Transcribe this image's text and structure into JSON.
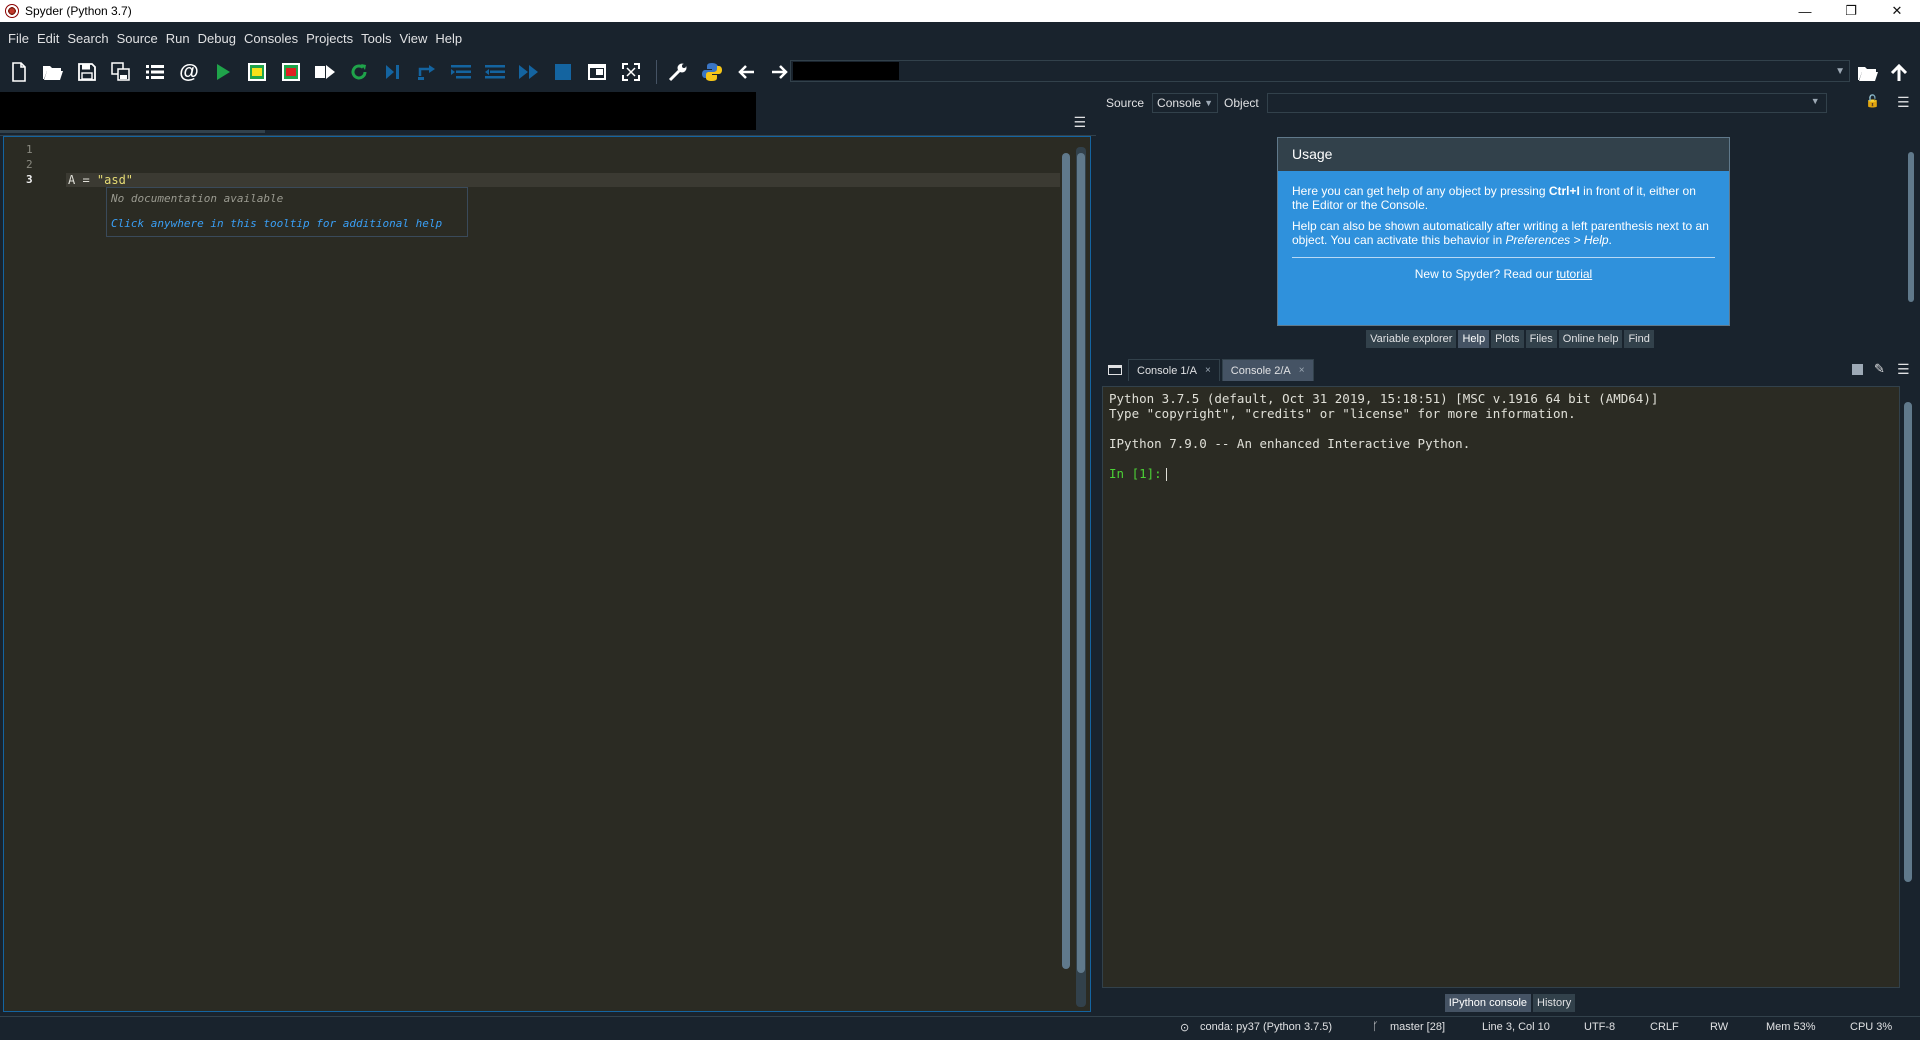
{
  "window": {
    "title": "Spyder (Python 3.7)",
    "controls": [
      "—",
      "❐",
      "✕"
    ]
  },
  "menu": [
    "File",
    "Edit",
    "Search",
    "Source",
    "Run",
    "Debug",
    "Consoles",
    "Projects",
    "Tools",
    "View",
    "Help"
  ],
  "toolbar": {
    "icons": [
      "new-file-icon",
      "open-file-icon",
      "save-icon",
      "save-all-icon",
      "outline-icon",
      "at-icon",
      "run-icon",
      "run-cell-icon",
      "run-cell-advance-icon",
      "run-selection-icon",
      "rerun-icon",
      "debug-icon",
      "step-icon",
      "step-into-icon",
      "step-return-icon",
      "continue-icon",
      "stop-debug-icon",
      "maximize-pane-icon",
      "fullscreen-icon",
      "preferences-wrench-icon",
      "python-path-icon",
      "back-arrow-icon",
      "forward-arrow-icon"
    ]
  },
  "editor": {
    "line_numbers": [
      "1",
      "2",
      "3"
    ],
    "current_line": "3",
    "code_prefix": "A = ",
    "code_string": "\"asd\"",
    "tooltip": {
      "no_doc": "No documentation available",
      "click_hint": "Click anywhere in this tooltip for additional help"
    }
  },
  "help": {
    "source_label": "Source",
    "source_value": "Console",
    "object_label": "Object",
    "usage": {
      "title": "Usage",
      "p1_a": "Here you can get help of any object by pressing ",
      "p1_key": "Ctrl+I",
      "p1_b": " in front of it, either on the Editor or the Console.",
      "p2_a": "Help can also be shown automatically after writing a left parenthesis next to an object. You can activate this behavior in ",
      "p2_em": "Preferences > Help",
      "p2_b": ".",
      "footer_text": "New to Spyder? Read our ",
      "footer_link": "tutorial"
    },
    "tabs": [
      "Variable explorer",
      "Help",
      "Plots",
      "Files",
      "Online help",
      "Find"
    ],
    "active_tab": "Help"
  },
  "console": {
    "tabs": [
      {
        "label": "Console 1/A",
        "close": "×"
      },
      {
        "label": "Console 2/A",
        "close": "×"
      }
    ],
    "active_tab": "Console 2/A",
    "lines": [
      "Python 3.7.5 (default, Oct 31 2019, 15:18:51) [MSC v.1916 64 bit (AMD64)]",
      "Type \"copyright\", \"credits\" or \"license\" for more information.",
      "",
      "IPython 7.9.0 -- An enhanced Interactive Python.",
      ""
    ],
    "prompt": "In [1]:",
    "bottom_tabs": [
      "IPython console",
      "History"
    ],
    "active_bottom_tab": "IPython console"
  },
  "statusbar": {
    "env": "conda: py37 (Python 3.7.5)",
    "git": "master [28]",
    "position": "Line 3, Col 10",
    "encoding": "UTF-8",
    "eol": "CRLF",
    "permissions": "RW",
    "memory": "Mem 53%",
    "cpu": "CPU 3%"
  },
  "colors": {
    "background": "#19232d",
    "editor_bg": "#2b2b23",
    "accent": "#1464a0",
    "usage_box": "#2f91dc",
    "prompt_green": "#4cd136",
    "string_yellow": "#e6db74"
  }
}
